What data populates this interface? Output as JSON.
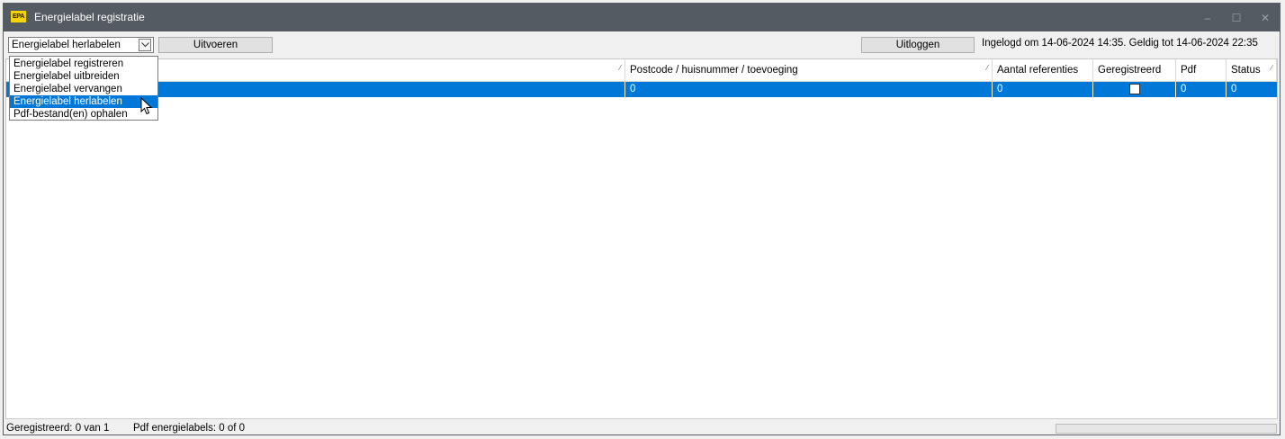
{
  "window": {
    "title": "Energielabel registratie",
    "logo_text": "EPA",
    "controls": {
      "minimize": "–",
      "maximize": "☐",
      "close": "✕"
    }
  },
  "toolbar": {
    "action_select_value": "Energielabel herlabelen",
    "run_label": "Uitvoeren",
    "logout_label": "Uitloggen",
    "login_info": "Ingelogd om 14-06-2024 14:35. Geldig tot 14-06-2024 22:35"
  },
  "dropdown": {
    "options": [
      "Energielabel registreren",
      "Energielabel uitbreiden",
      "Energielabel vervangen",
      "Energielabel herlabelen",
      "Pdf-bestand(en) ophalen"
    ],
    "selected_index": 3
  },
  "grid": {
    "columns": [
      "",
      "Postcode / huisnummer / toevoeging",
      "Aantal referenties",
      "Geregistreerd",
      "Pdf",
      "Status"
    ],
    "rows": [
      {
        "first": "",
        "postcode": "0",
        "referenties": "0",
        "geregistreerd": false,
        "pdf": "0",
        "status": "0"
      }
    ]
  },
  "status": {
    "registered": "Geregistreerd: 0 van 1",
    "pdf": "Pdf energielabels: 0 of 0"
  },
  "colors": {
    "titlebar": "#555b63",
    "selection": "#0078d7",
    "logo": "#f5d300"
  }
}
